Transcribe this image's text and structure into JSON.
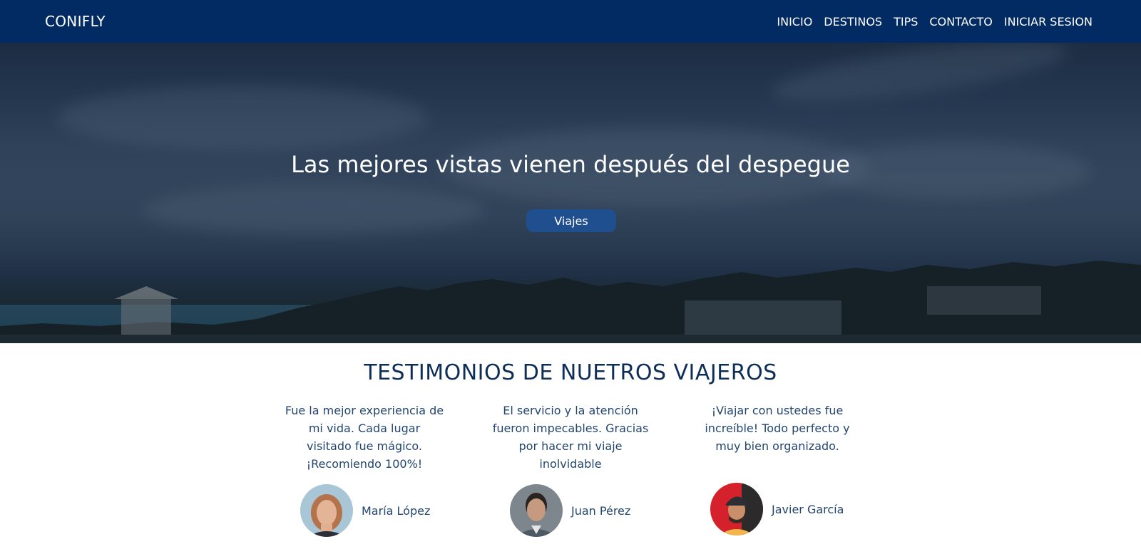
{
  "navbar": {
    "brand": "CONIFLY",
    "links": [
      "INICIO",
      "DESTINOS",
      "TIPS",
      "CONTACTO",
      "INICIAR SESION"
    ]
  },
  "hero": {
    "title": "Las mejores vistas vienen después del despegue",
    "button_label": "Viajes"
  },
  "testimonials": {
    "title": "TESTIMONIOS DE NUETROS VIAJEROS",
    "items": [
      {
        "quote": "Fue la mejor experiencia de mi vida. Cada lugar visitado fue mágico. ¡Recomiendo 100%!",
        "author": "María López"
      },
      {
        "quote": "El servicio y la atención fueron impecables. Gracias por hacer mi viaje inolvidable",
        "author": "Juan Pérez"
      },
      {
        "quote": "¡Viajar con ustedes fue increíble! Todo perfecto y muy bien organizado.",
        "author": "Javier García"
      }
    ]
  },
  "colors": {
    "navbar": "#022b63",
    "button": "#1f4f8e",
    "text_dark": "#0e2e58"
  }
}
